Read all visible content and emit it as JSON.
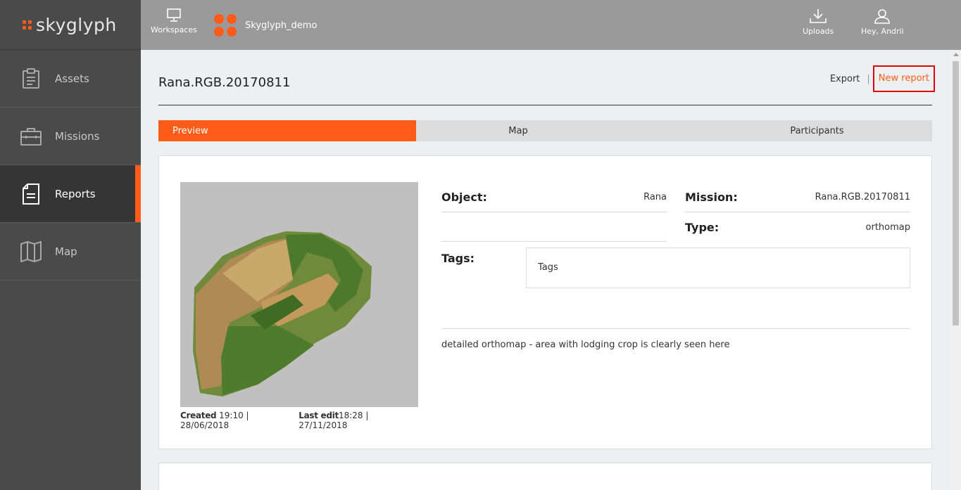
{
  "brand": {
    "name": "skyglyph"
  },
  "sidebar": {
    "items": [
      {
        "label": "Assets",
        "icon": "clipboard-icon"
      },
      {
        "label": "Missions",
        "icon": "briefcase-icon"
      },
      {
        "label": "Reports",
        "icon": "document-icon",
        "active": true
      },
      {
        "label": "Map",
        "icon": "map-icon"
      }
    ]
  },
  "topbar": {
    "workspaces_label": "Workspaces",
    "workspace_name": "Skyglyph_demo",
    "uploads_label": "Uploads",
    "user_label": "Hey, Andrii"
  },
  "page": {
    "title": "Rana.RGB.20170811",
    "export_label": "Export",
    "separator": "|",
    "new_report_label": "New report"
  },
  "tabs": [
    {
      "label": "Preview",
      "active": true
    },
    {
      "label": "Map"
    },
    {
      "label": "Participants"
    }
  ],
  "report": {
    "created_label": "Created",
    "created_value": "19:10 | 28/06/2018",
    "last_edit_label": "Last edit",
    "last_edit_value": "18:28 | 27/11/2018",
    "object_label": "Object:",
    "object_value": "Rana",
    "mission_label": "Mission:",
    "mission_value": "Rana.RGB.20170811",
    "type_label": "Type:",
    "type_value": "orthomap",
    "tags_label": "Tags:",
    "tags_placeholder": "Tags",
    "description": "detailed orthomap - area with lodging crop is clearly seen here"
  },
  "colors": {
    "accent": "#ff5c1a",
    "sidebar": "#4a4a4a",
    "topbar": "#9a9a9a",
    "highlight_border": "#e00000"
  }
}
